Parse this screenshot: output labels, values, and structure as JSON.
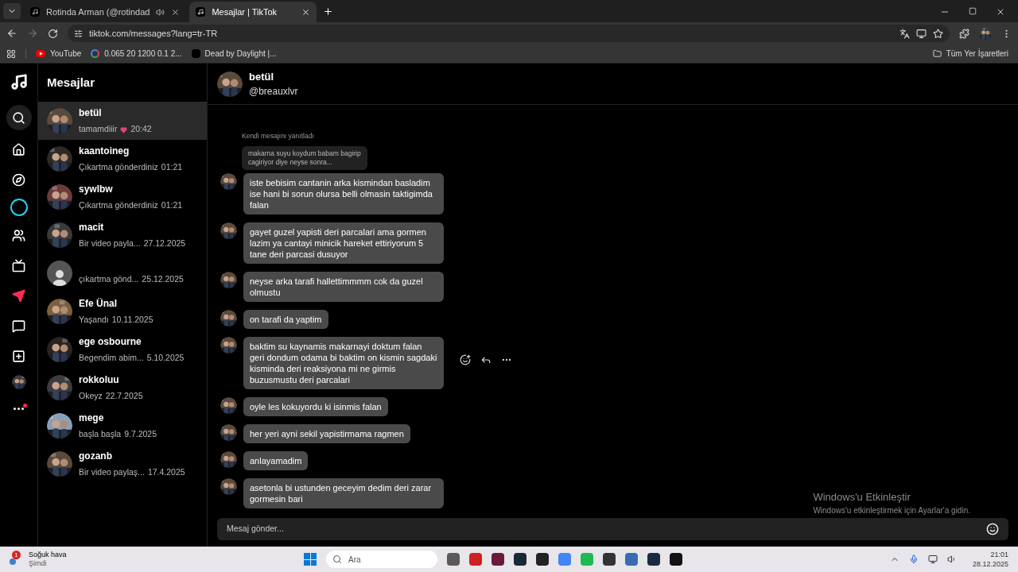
{
  "browser": {
    "tabs": [
      {
        "title": "Rotinda Arman (@rotindad",
        "selected": false,
        "audio": true
      },
      {
        "title": "Mesajlar | TikTok",
        "selected": true,
        "audio": false
      }
    ],
    "url": "tiktok.com/messages?lang=tr-TR",
    "bookmarks": [
      {
        "label": "YouTube",
        "kind": "youtube"
      },
      {
        "label": "0.065 20 1200 0.1 2...",
        "kind": "google"
      },
      {
        "label": "Dead by Daylight |...",
        "kind": "game"
      }
    ],
    "all_bookmarks": "Tüm Yer İşaretleri"
  },
  "nav": {
    "items": [
      {
        "kind": "search",
        "selected": false
      },
      {
        "kind": "home",
        "selected": false
      },
      {
        "kind": "explore",
        "selected": false
      },
      {
        "kind": "live",
        "selected": false
      },
      {
        "kind": "friends",
        "selected": false
      },
      {
        "kind": "tv",
        "selected": false
      },
      {
        "kind": "messages",
        "selected": true
      },
      {
        "kind": "inbox",
        "selected": false
      },
      {
        "kind": "upload",
        "selected": false
      },
      {
        "kind": "profile",
        "selected": false
      },
      {
        "kind": "more",
        "selected": false
      }
    ]
  },
  "inbox": {
    "title": "Mesajlar",
    "conversations": [
      {
        "name": "betül",
        "preview": "tamamdiiir",
        "emoji": true,
        "time": "20:42",
        "selected": true
      },
      {
        "name": "kaantoineg",
        "preview": "Çıkartma gönderdiniz",
        "emoji": false,
        "time": "01:21",
        "selected": false
      },
      {
        "name": "sywlbw",
        "preview": "Çıkartma gönderdiniz",
        "emoji": false,
        "time": "01:21",
        "selected": false
      },
      {
        "name": "macit",
        "preview": "Bir video payla...",
        "emoji": false,
        "time": "27.12.2025",
        "selected": false
      },
      {
        "kind": "default",
        "preview": "çıkartma gönd...",
        "emoji": false,
        "time": "25.12.2025",
        "selected": false
      },
      {
        "name": "Efe Ünal",
        "preview": "Yaşandı",
        "emoji": false,
        "time": "10.11.2025",
        "selected": false
      },
      {
        "name": "ege osbourne",
        "preview": "Begendim abim...",
        "emoji": false,
        "time": "5.10.2025",
        "selected": false
      },
      {
        "name": "rokkoluu",
        "preview": "Okeyz",
        "emoji": false,
        "time": "22.7.2025",
        "selected": false
      },
      {
        "name": "mege",
        "preview": "başla başla",
        "emoji": false,
        "time": "9.7.2025",
        "selected": false
      },
      {
        "name": "gozanb",
        "preview": "Bir video paylaş...",
        "emoji": false,
        "time": "17.4.2025",
        "selected": false
      }
    ]
  },
  "chat": {
    "name": "betül",
    "handle": "@breauxlvr",
    "messages": [
      {
        "kind": "reply_quote",
        "label": "Kendi mesajını yanıtladı",
        "text": "makarna suyu koydum babam bagirip cagiriyor diye neyse sonra..."
      },
      {
        "kind": "message",
        "text": "iste bebisim cantanin arka kismindan basladim ise hani bi sorun olursa belli olmasin taktigimda falan",
        "hovered": false
      },
      {
        "kind": "message",
        "text": "gayet guzel yapisti deri parcalari ama gormen lazim ya cantayi minicik hareket ettiriyorum 5 tane deri parcasi dusuyor",
        "hovered": false
      },
      {
        "kind": "message",
        "text": "neyse arka tarafi hallettimmmm cok da guzel olmustu",
        "hovered": false
      },
      {
        "kind": "message",
        "text": "on tarafi da yaptim",
        "hovered": false
      },
      {
        "kind": "message",
        "text": "baktim su kaynamis makarnayi doktum falan geri dondum odama bi baktim on kismin sagdaki kisminda deri reaksiyona mi ne girmis buzusmustu deri parcalari",
        "hovered": true
      },
      {
        "kind": "message",
        "text": "oyle les kokuyordu ki isinmis falan",
        "hovered": false
      },
      {
        "kind": "message",
        "text": "her yeri ayni sekil yapistirmama ragmen",
        "hovered": false
      },
      {
        "kind": "message",
        "text": "anlayamadim",
        "hovered": false
      },
      {
        "kind": "message",
        "text": "asetonla bi ustunden geceyim dedim deri zarar gormesin bari",
        "hovered": false
      }
    ],
    "input_placeholder": "Mesaj gönder..."
  },
  "activation": {
    "title": "Windows'u Etkinleştir",
    "subtitle": "Windows'u etkinleştirmek için Ayarlar'a gidin."
  },
  "taskbar": {
    "weather": {
      "badge": "1",
      "title": "Soğuk hava",
      "subtitle": "Şimdi"
    },
    "search": "Ara",
    "time": "21:01",
    "date": "28.12.2025"
  }
}
